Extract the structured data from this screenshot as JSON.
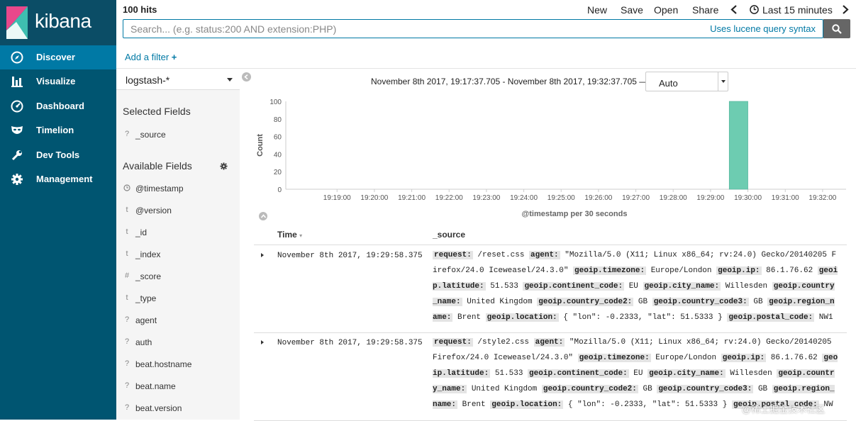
{
  "app": {
    "logo_text": "kibana",
    "brand_color": "#005571",
    "active_color": "#0079a5"
  },
  "nav": [
    {
      "label": "Discover",
      "icon": "compass-icon",
      "active": true
    },
    {
      "label": "Visualize",
      "icon": "bar-chart-icon"
    },
    {
      "label": "Dashboard",
      "icon": "dashboard-icon"
    },
    {
      "label": "Timelion",
      "icon": "mask-icon"
    },
    {
      "label": "Dev Tools",
      "icon": "wrench-icon"
    },
    {
      "label": "Management",
      "icon": "gear-icon"
    }
  ],
  "topbar": {
    "hits": "100 hits",
    "new": "New",
    "save": "Save",
    "open": "Open",
    "share": "Share",
    "time_label": "Last 15 minutes"
  },
  "search": {
    "placeholder": "Search... (e.g. status:200 AND extension:PHP)",
    "value": "",
    "syntax_link": "Uses lucene query syntax"
  },
  "filter": {
    "add_label": "Add a filter"
  },
  "sidebar": {
    "index_pattern": "logstash-*",
    "selected_title": "Selected Fields",
    "selected_fields": [
      {
        "type": "?",
        "name": "_source"
      }
    ],
    "available_title": "Available Fields",
    "available_fields": [
      {
        "type": "clock",
        "name": "@timestamp"
      },
      {
        "type": "t",
        "name": "@version"
      },
      {
        "type": "t",
        "name": "_id"
      },
      {
        "type": "t",
        "name": "_index"
      },
      {
        "type": "#",
        "name": "_score"
      },
      {
        "type": "t",
        "name": "_type"
      },
      {
        "type": "?",
        "name": "agent"
      },
      {
        "type": "?",
        "name": "auth"
      },
      {
        "type": "?",
        "name": "beat.hostname"
      },
      {
        "type": "?",
        "name": "beat.name"
      },
      {
        "type": "?",
        "name": "beat.version"
      }
    ]
  },
  "histogram": {
    "time_range": "November 8th 2017, 19:17:37.705 - November 8th 2017, 19:32:37.705 —",
    "interval": "Auto"
  },
  "chart_data": {
    "type": "bar",
    "bar_color": "#6dccb1",
    "xlabel": "@timestamp per 30 seconds",
    "ylabel": "Count",
    "ylim": [
      0,
      100
    ],
    "yticks": [
      0,
      20,
      40,
      60,
      80,
      100
    ],
    "xlim": [
      "19:17:37.705",
      "19:32:37.705"
    ],
    "xticks": [
      "19:19:00",
      "19:20:00",
      "19:21:00",
      "19:22:00",
      "19:23:00",
      "19:24:00",
      "19:25:00",
      "19:26:00",
      "19:27:00",
      "19:28:00",
      "19:29:00",
      "19:30:00",
      "19:31:00",
      "19:32:00"
    ],
    "bars": [
      {
        "start": "19:29:30",
        "end": "19:30:00",
        "value": 100
      }
    ]
  },
  "table": {
    "col_time": "Time",
    "col_source": "_source",
    "rows": [
      {
        "time": "November 8th 2017, 19:29:58.375",
        "fields": [
          {
            "k": "request:",
            "v": "/reset.css"
          },
          {
            "k": "agent:",
            "v": "\"Mozilla/5.0 (X11; Linux x86_64; rv:24.0) Gecko/20140205 Firefox/24.0 Iceweasel/24.3.0\""
          },
          {
            "k": "geoip.timezone:",
            "v": "Europe/London"
          },
          {
            "k": "geoip.ip:",
            "v": "86.1.76.62"
          },
          {
            "k": "geoip.latitude:",
            "v": "51.533"
          },
          {
            "k": "geoip.continent_code:",
            "v": "EU"
          },
          {
            "k": "geoip.city_name:",
            "v": "Willesden"
          },
          {
            "k": "geoip.country_name:",
            "v": "United Kingdom"
          },
          {
            "k": "geoip.country_code2:",
            "v": "GB"
          },
          {
            "k": "geoip.country_code3:",
            "v": "GB"
          },
          {
            "k": "geoip.region_name:",
            "v": "Brent"
          },
          {
            "k": "geoip.location:",
            "v": "{ \"lon\": -0.2333, \"lat\": 51.5333 }"
          },
          {
            "k": "geoip.postal_code:",
            "v": "NW1"
          }
        ]
      },
      {
        "time": "November 8th 2017, 19:29:58.375",
        "fields": [
          {
            "k": "request:",
            "v": "/style2.css"
          },
          {
            "k": "agent:",
            "v": "\"Mozilla/5.0 (X11; Linux x86_64; rv:24.0) Gecko/20140205 Firefox/24.0 Iceweasel/24.3.0\""
          },
          {
            "k": "geoip.timezone:",
            "v": "Europe/London"
          },
          {
            "k": "geoip.ip:",
            "v": "86.1.76.62"
          },
          {
            "k": "geoip.latitude:",
            "v": "51.533"
          },
          {
            "k": "geoip.continent_code:",
            "v": "EU"
          },
          {
            "k": "geoip.city_name:",
            "v": "Willesden"
          },
          {
            "k": "geoip.country_name:",
            "v": "United Kingdom"
          },
          {
            "k": "geoip.country_code2:",
            "v": "GB"
          },
          {
            "k": "geoip.country_code3:",
            "v": "GB"
          },
          {
            "k": "geoip.region_name:",
            "v": "Brent"
          },
          {
            "k": "geoip.location:",
            "v": "{ \"lon\": -0.2333, \"lat\": 51.5333 }"
          },
          {
            "k": "geoip.postal_code:",
            "v": "NW"
          }
        ]
      }
    ]
  },
  "watermark": "@稀土掘金技术社区"
}
